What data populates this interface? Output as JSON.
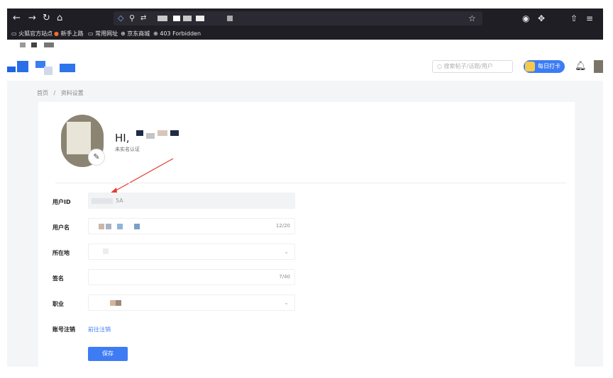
{
  "bookmarks": [
    "火狐官方站点",
    "新手上路",
    "常用网址",
    "京东商城",
    "403 Forbidden"
  ],
  "header": {
    "search_placeholder": "搜索帖子/话题/用户",
    "checkin_label": "每日打卡"
  },
  "breadcrumb": {
    "home": "首页",
    "separator": "/",
    "current": "资料设置"
  },
  "profile": {
    "greeting": "HI,",
    "verify_status": "未实名认证"
  },
  "form": {
    "user_id": {
      "label": "用户ID",
      "value_visible": "5A"
    },
    "username": {
      "label": "用户名",
      "counter": "12/20"
    },
    "location": {
      "label": "所在地"
    },
    "signature": {
      "label": "签名",
      "counter": "7/40"
    },
    "occupation": {
      "label": "职业"
    },
    "account_cancel": {
      "label": "账号注销",
      "link": "前往注销"
    },
    "save_label": "保存"
  },
  "colors": {
    "accent": "#3d7cf3",
    "arrow": "#e23b2e",
    "browser_chrome": "#1f1e25"
  }
}
